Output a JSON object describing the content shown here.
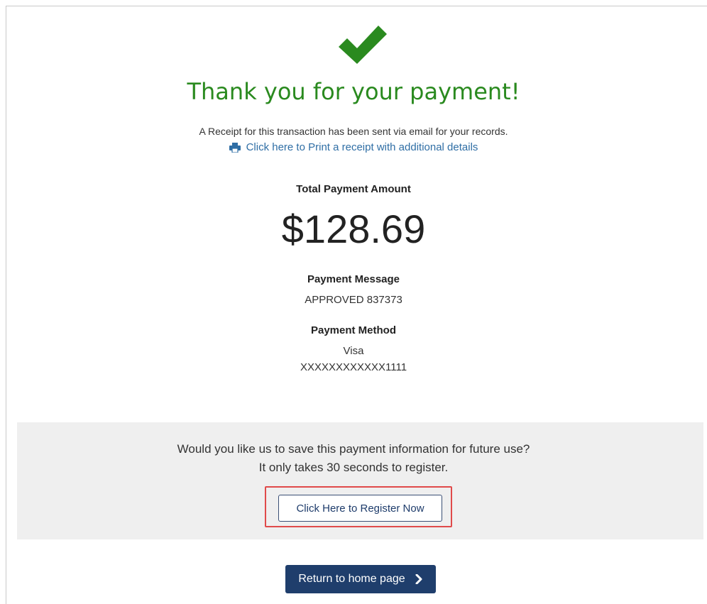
{
  "header": {
    "title": "Thank you for your payment!",
    "receipt_note": "A Receipt for this transaction has been sent via email for your records.",
    "print_link": "Click here to Print a receipt with additional details"
  },
  "payment": {
    "total_label": "Total Payment Amount",
    "total_amount": "$128.69",
    "message_label": "Payment Message",
    "message_value": "APPROVED 837373",
    "method_label": "Payment Method",
    "method_type": "Visa",
    "method_number": "XXXXXXXXXXXX1111"
  },
  "register": {
    "line1": "Would you like us to save this payment information for future use?",
    "line2": "It only takes 30 seconds to register.",
    "button_label": "Click Here to Register Now"
  },
  "footer": {
    "home_button_label": "Return to home page"
  },
  "colors": {
    "success_green": "#2a8a1f",
    "link_blue": "#2f6ea5",
    "navy": "#1f3e6c",
    "highlight_red": "#e04a4a",
    "panel_gray": "#efefef"
  },
  "icons": {
    "success": "checkmark-icon",
    "print": "printer-icon",
    "chevron": "chevron-right-icon"
  }
}
